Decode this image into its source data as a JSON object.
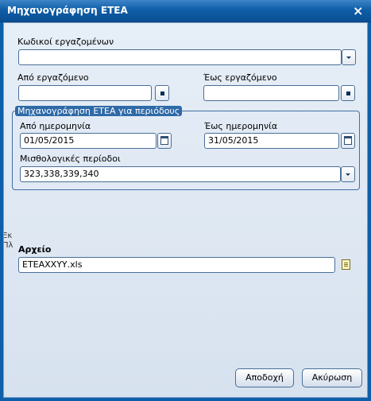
{
  "window": {
    "title": "Μηχανογράφηση ΕΤΕΑ",
    "close_glyph": "×"
  },
  "form": {
    "employee_codes": {
      "label": "Κωδικοί εργαζομένων",
      "value": ""
    },
    "from_employee": {
      "label": "Από εργαζόμενο",
      "value": ""
    },
    "to_employee": {
      "label": "Έως εργαζόμενο",
      "value": ""
    },
    "period_group": {
      "title": "Μηχανογράφηση ΕΤΕΑ για περιόδους",
      "from_date": {
        "label": "Από ημερομηνία",
        "value": "01/05/2015"
      },
      "to_date": {
        "label": "Έως ημερομηνία",
        "value": "31/05/2015"
      },
      "payroll_periods": {
        "label": "Μισθολογικές περίοδοι",
        "value": "323,338,339,340"
      }
    },
    "file": {
      "label": "Αρχείο",
      "value": "ΕΤΕΑΧΧΥΥ.xls"
    }
  },
  "edge_fragments": [
    "Εκ",
    "Πλ"
  ],
  "buttons": {
    "ok": "Αποδοχή",
    "cancel": "Ακύρωση"
  },
  "icons": {
    "close": "close-icon",
    "dropdown": "chevron-down-icon",
    "lookup": "lookup-icon",
    "calendar": "calendar-icon",
    "file": "file-browse-icon"
  },
  "colors": {
    "titlebar": "#0f5ea8",
    "client_bg": "#dfe8f3",
    "group_border": "#3f6fa3",
    "group_title_bg": "#2f6aa7"
  }
}
